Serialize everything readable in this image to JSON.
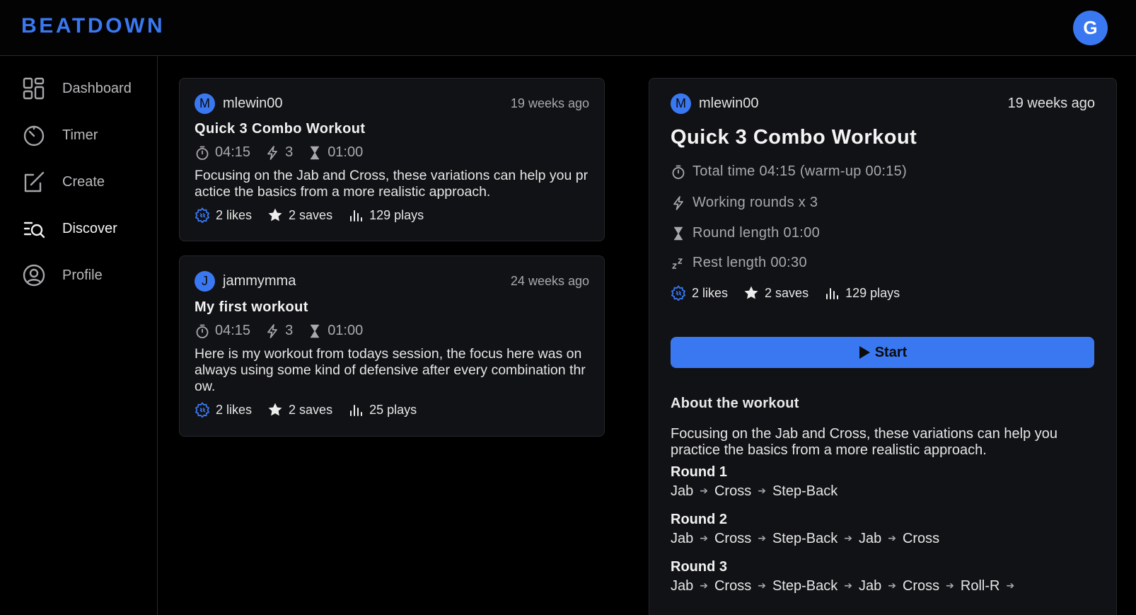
{
  "brand": "BEATDOWN",
  "user_initial": "G",
  "colors": {
    "accent": "#3a78f2",
    "background": "#000000",
    "card": "#111215"
  },
  "sidebar": {
    "items": [
      {
        "label": "Dashboard",
        "icon": "dashboard-icon",
        "active": false
      },
      {
        "label": "Timer",
        "icon": "timer-icon",
        "active": false
      },
      {
        "label": "Create",
        "icon": "create-icon",
        "active": false
      },
      {
        "label": "Discover",
        "icon": "discover-icon",
        "active": true
      },
      {
        "label": "Profile",
        "icon": "profile-icon",
        "active": false
      }
    ]
  },
  "feed": [
    {
      "initial": "M",
      "username": "mlewin00",
      "ago": "19 weeks ago",
      "title": "Quick 3 Combo Workout",
      "time": "04:15",
      "rounds": "3",
      "round_length": "01:00",
      "description": "Focusing on the Jab and Cross, these variations can help you practice the basics from a more realistic approach.",
      "likes": "2 likes",
      "saves": "2 saves",
      "plays": "129 plays"
    },
    {
      "initial": "J",
      "username": "jammymma",
      "ago": "24 weeks ago",
      "title": "My first workout",
      "time": "04:15",
      "rounds": "3",
      "round_length": "01:00",
      "description": "Here is my workout from todays session, the focus here was on always using some kind of defensive after every combination throw.",
      "likes": "2 likes",
      "saves": "2 saves",
      "plays": "25 plays"
    }
  ],
  "detail": {
    "initial": "M",
    "username": "mlewin00",
    "ago": "19 weeks ago",
    "title": "Quick 3 Combo Workout",
    "total_time": "Total time 04:15 (warm-up 00:15)",
    "working_rounds": "Working rounds x 3",
    "round_length": "Round length 01:00",
    "rest_length": "Rest length 00:30",
    "likes": "2 likes",
    "saves": "2 saves",
    "plays": "129 plays",
    "start_label": "Start",
    "about_heading": "About the workout",
    "about_text": "Focusing on the Jab and Cross, these variations can help you practice the basics from a more realistic approach.",
    "rounds": [
      {
        "title": "Round 1",
        "moves": [
          "Jab",
          "Cross",
          "Step-Back"
        ]
      },
      {
        "title": "Round 2",
        "moves": [
          "Jab",
          "Cross",
          "Step-Back",
          "Jab",
          "Cross"
        ]
      },
      {
        "title": "Round 3",
        "moves": [
          "Jab",
          "Cross",
          "Step-Back",
          "Jab",
          "Cross",
          "Roll-R"
        ]
      }
    ]
  }
}
